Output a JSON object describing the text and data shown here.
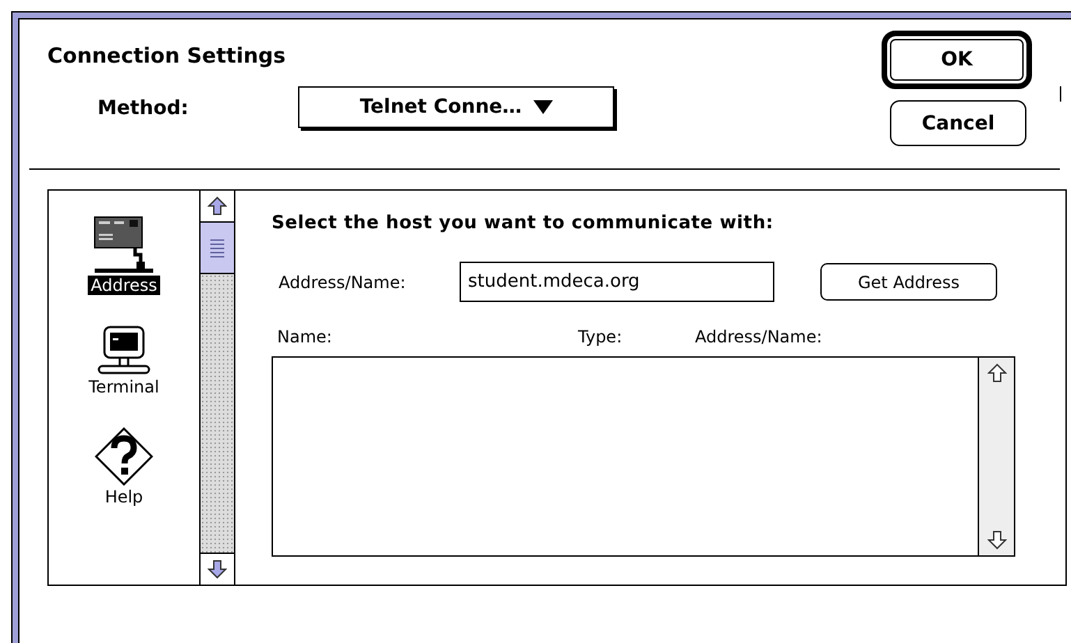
{
  "dialog": {
    "title": "Connection Settings",
    "method_label": "Method:",
    "method_value": "Telnet Conne…",
    "buttons": [
      {
        "label": "OK",
        "default": true
      },
      {
        "label": "Cancel",
        "default": false
      }
    ]
  },
  "tools": {
    "items": [
      {
        "label": "Address",
        "kind": "address",
        "selected": true
      },
      {
        "label": "Terminal",
        "kind": "terminal",
        "selected": false
      },
      {
        "label": "Help",
        "kind": "help",
        "selected": false
      }
    ]
  },
  "host": {
    "heading": "Select the host you want to communicate with:",
    "address_label": "Address/Name:",
    "address_value": "student.mdeca.org",
    "get_button": "Get Address",
    "columns": [
      "Name:",
      "Type:",
      "Address/Name:"
    ]
  }
}
